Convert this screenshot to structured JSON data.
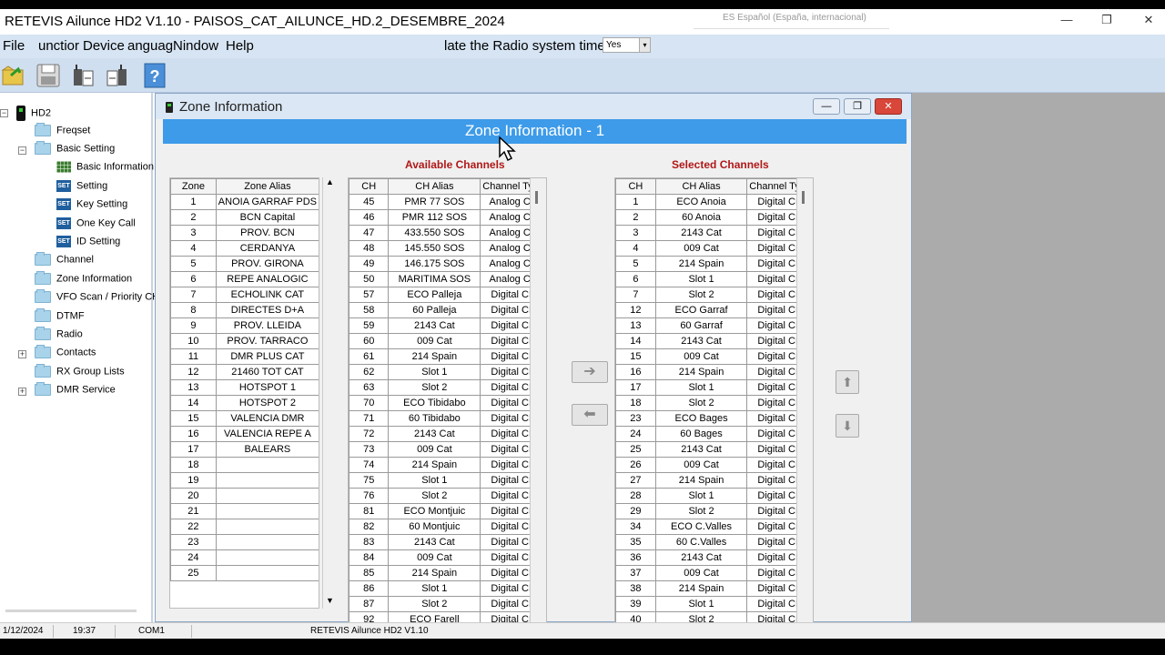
{
  "window": {
    "title": "RETEVIS Ailunce HD2 V1.10  -  PAISOS_CAT_AILUNCE_HD.2_DESEMBRE_2024",
    "language_input": "ES Español (España, internacional)",
    "minimize": "—",
    "restore": "❐",
    "close": "✕"
  },
  "menu": {
    "items": [
      "File",
      "unctior",
      "Device",
      "anguag",
      "Nindow",
      "Help"
    ],
    "update_time_label": "late the Radio system time",
    "update_time_value": "Yes",
    "dropdown_arrow": "▾"
  },
  "tree": {
    "root": "HD2",
    "items": [
      {
        "label": "Freqset"
      },
      {
        "label": "Basic Setting"
      },
      {
        "label": "Basic Information"
      },
      {
        "label": "Setting"
      },
      {
        "label": "Key Setting"
      },
      {
        "label": "One Key Call"
      },
      {
        "label": "ID Setting"
      },
      {
        "label": "Channel"
      },
      {
        "label": "Zone Information"
      },
      {
        "label": "VFO Scan / Priority CH"
      },
      {
        "label": "DTMF"
      },
      {
        "label": "Radio"
      },
      {
        "label": "Contacts"
      },
      {
        "label": "RX Group Lists"
      },
      {
        "label": "DMR Service"
      }
    ],
    "set_badge": "SET",
    "expand": "+",
    "collapse": "−"
  },
  "zone_window": {
    "title": "Zone Information",
    "banner": "Zone Information - 1",
    "available_title": "Available Channels",
    "selected_title": "Selected Channels",
    "btn_add": "➔",
    "btn_remove": "⬅",
    "btn_up": "⬆",
    "btn_down": "⬇"
  },
  "zone_table": {
    "headers": [
      "Zone",
      "Zone Alias"
    ],
    "rows": [
      [
        "1",
        "ANOIA GARRAF PDS"
      ],
      [
        "2",
        "BCN Capital"
      ],
      [
        "3",
        "PROV. BCN"
      ],
      [
        "4",
        "CERDANYA"
      ],
      [
        "5",
        "PROV. GIRONA"
      ],
      [
        "6",
        "REPE ANALOGIC"
      ],
      [
        "7",
        "ECHOLINK CAT"
      ],
      [
        "8",
        "DIRECTES D+A"
      ],
      [
        "9",
        "PROV. LLEIDA"
      ],
      [
        "10",
        "PROV. TARRACO"
      ],
      [
        "11",
        "DMR PLUS CAT"
      ],
      [
        "12",
        "21460 TOT CAT"
      ],
      [
        "13",
        "HOTSPOT 1"
      ],
      [
        "14",
        "HOTSPOT 2"
      ],
      [
        "15",
        "VALENCIA DMR"
      ],
      [
        "16",
        "VALENCIA REPE A"
      ],
      [
        "17",
        "BALEARS"
      ],
      [
        "18",
        ""
      ],
      [
        "19",
        ""
      ],
      [
        "20",
        ""
      ],
      [
        "21",
        ""
      ],
      [
        "22",
        ""
      ],
      [
        "23",
        ""
      ],
      [
        "24",
        ""
      ],
      [
        "25",
        ""
      ]
    ]
  },
  "available_table": {
    "headers": [
      "CH",
      "CH Alias",
      "Channel Type"
    ],
    "rows": [
      [
        "45",
        "PMR 77 SOS",
        "Analog CH"
      ],
      [
        "46",
        "PMR 112 SOS",
        "Analog CH"
      ],
      [
        "47",
        "433.550 SOS",
        "Analog CH"
      ],
      [
        "48",
        "145.550 SOS",
        "Analog CH"
      ],
      [
        "49",
        "146.175 SOS",
        "Analog CH"
      ],
      [
        "50",
        "MARITIMA SOS",
        "Analog CH"
      ],
      [
        "57",
        "ECO Palleja",
        "Digital CH"
      ],
      [
        "58",
        "60 Palleja",
        "Digital CH"
      ],
      [
        "59",
        "2143 Cat",
        "Digital CH"
      ],
      [
        "60",
        "009 Cat",
        "Digital CH"
      ],
      [
        "61",
        "214 Spain",
        "Digital CH"
      ],
      [
        "62",
        "Slot 1",
        "Digital CH"
      ],
      [
        "63",
        "Slot 2",
        "Digital CH"
      ],
      [
        "70",
        "ECO Tibidabo",
        "Digital CH"
      ],
      [
        "71",
        "60 Tibidabo",
        "Digital CH"
      ],
      [
        "72",
        "2143 Cat",
        "Digital CH"
      ],
      [
        "73",
        "009 Cat",
        "Digital CH"
      ],
      [
        "74",
        "214 Spain",
        "Digital CH"
      ],
      [
        "75",
        "Slot 1",
        "Digital CH"
      ],
      [
        "76",
        "Slot 2",
        "Digital CH"
      ],
      [
        "81",
        "ECO Montjuic",
        "Digital CH"
      ],
      [
        "82",
        "60 Montjuic",
        "Digital CH"
      ],
      [
        "83",
        "2143 Cat",
        "Digital CH"
      ],
      [
        "84",
        "009 Cat",
        "Digital CH"
      ],
      [
        "85",
        "214 Spain",
        "Digital CH"
      ],
      [
        "86",
        "Slot 1",
        "Digital CH"
      ],
      [
        "87",
        "Slot 2",
        "Digital CH"
      ],
      [
        "92",
        "ECO Farell",
        "Digital CH"
      ]
    ]
  },
  "selected_table": {
    "headers": [
      "CH",
      "CH Alias",
      "Channel Type"
    ],
    "rows": [
      [
        "1",
        "ECO Anoia",
        "Digital CH"
      ],
      [
        "2",
        "60 Anoia",
        "Digital CH"
      ],
      [
        "3",
        "2143 Cat",
        "Digital CH"
      ],
      [
        "4",
        "009 Cat",
        "Digital CH"
      ],
      [
        "5",
        "214 Spain",
        "Digital CH"
      ],
      [
        "6",
        "Slot 1",
        "Digital CH"
      ],
      [
        "7",
        "Slot 2",
        "Digital CH"
      ],
      [
        "12",
        "ECO Garraf",
        "Digital CH"
      ],
      [
        "13",
        "60 Garraf",
        "Digital CH"
      ],
      [
        "14",
        "2143 Cat",
        "Digital CH"
      ],
      [
        "15",
        "009 Cat",
        "Digital CH"
      ],
      [
        "16",
        "214 Spain",
        "Digital CH"
      ],
      [
        "17",
        "Slot 1",
        "Digital CH"
      ],
      [
        "18",
        "Slot 2",
        "Digital CH"
      ],
      [
        "23",
        "ECO Bages",
        "Digital CH"
      ],
      [
        "24",
        "60 Bages",
        "Digital CH"
      ],
      [
        "25",
        "2143 Cat",
        "Digital CH"
      ],
      [
        "26",
        "009 Cat",
        "Digital CH"
      ],
      [
        "27",
        "214 Spain",
        "Digital CH"
      ],
      [
        "28",
        "Slot 1",
        "Digital CH"
      ],
      [
        "29",
        "Slot 2",
        "Digital CH"
      ],
      [
        "34",
        "ECO C.Valles",
        "Digital CH"
      ],
      [
        "35",
        "60 C.Valles",
        "Digital CH"
      ],
      [
        "36",
        "2143 Cat",
        "Digital CH"
      ],
      [
        "37",
        "009 Cat",
        "Digital CH"
      ],
      [
        "38",
        "214 Spain",
        "Digital CH"
      ],
      [
        "39",
        "Slot 1",
        "Digital CH"
      ],
      [
        "40",
        "Slot 2",
        "Digital CH"
      ]
    ]
  },
  "status": {
    "date": "1/12/2024",
    "time": "19:37",
    "port": "COM1",
    "app": "RETEVIS Ailunce HD2 V1.10"
  },
  "scroll": {
    "up": "▲",
    "down": "▼"
  }
}
